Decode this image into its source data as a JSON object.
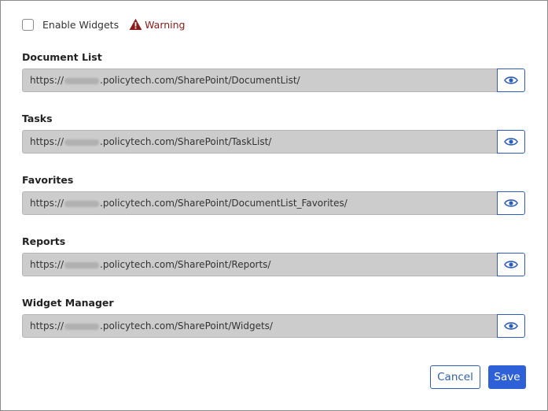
{
  "enable_widgets": {
    "label": "Enable Widgets",
    "checked": false
  },
  "warning": {
    "label": "Warning",
    "icon": "warning-triangle-icon",
    "color": "#8b1a1a"
  },
  "fields": [
    {
      "label": "Document List",
      "url_prefix": "https://",
      "url_suffix": ".policytech.com/SharePoint/DocumentList/"
    },
    {
      "label": "Tasks",
      "url_prefix": "https://",
      "url_suffix": ".policytech.com/SharePoint/TaskList/"
    },
    {
      "label": "Favorites",
      "url_prefix": "https://",
      "url_suffix": ".policytech.com/SharePoint/DocumentList_Favorites/"
    },
    {
      "label": "Reports",
      "url_prefix": "https://",
      "url_suffix": ".policytech.com/SharePoint/Reports/"
    },
    {
      "label": "Widget Manager",
      "url_prefix": "https://",
      "url_suffix": ".policytech.com/SharePoint/Widgets/"
    }
  ],
  "buttons": {
    "cancel": "Cancel",
    "save": "Save"
  },
  "colors": {
    "accent": "#2e60d8",
    "input_bg": "#cccccc",
    "warning": "#8b1a1a"
  }
}
